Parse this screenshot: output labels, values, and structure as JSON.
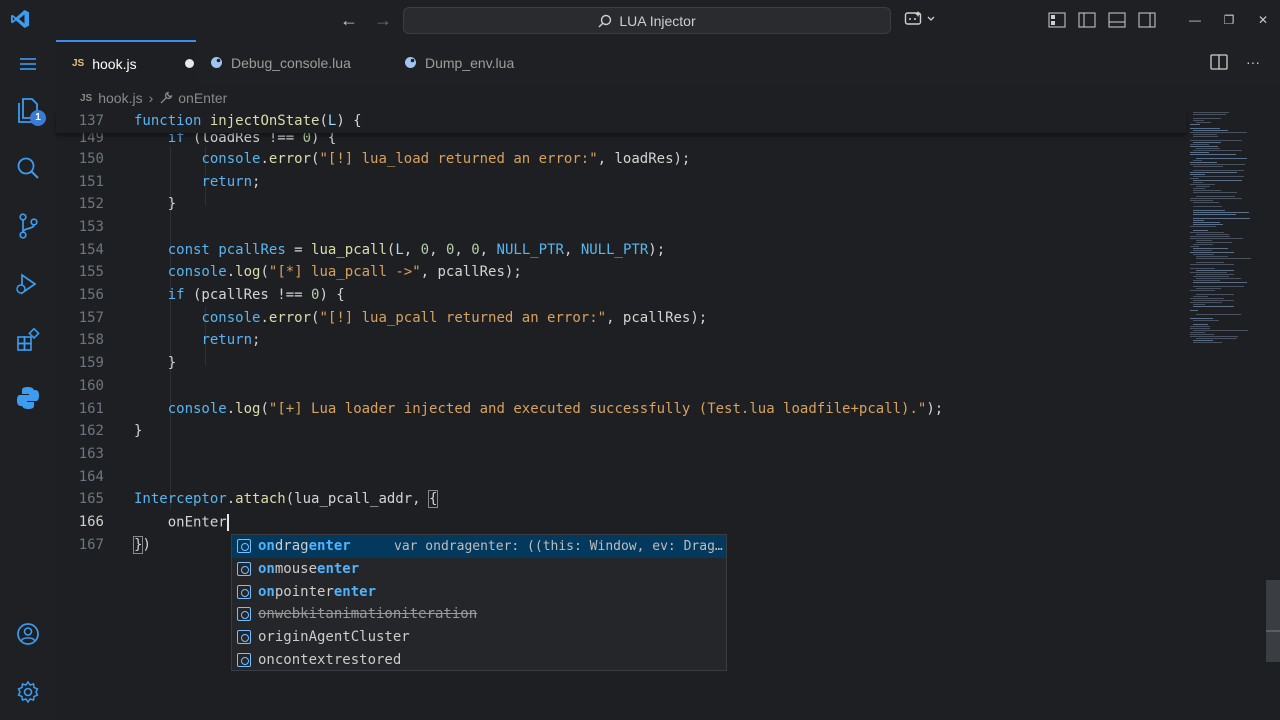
{
  "titlebar": {
    "search_text": "LUA Injector",
    "back_icon": "arrow-left-icon",
    "forward_icon": "arrow-right-icon",
    "window_controls": [
      "—",
      "❐",
      "✕"
    ]
  },
  "activity": {
    "explorer_badge": "1"
  },
  "tabs": [
    {
      "label": "hook.js",
      "badge": "JS",
      "active": true,
      "dirty": true
    },
    {
      "label": "Debug_console.lua",
      "active": false
    },
    {
      "label": "Dump_env.lua",
      "active": false
    }
  ],
  "breadcrumb": {
    "badge": "JS",
    "file": "hook.js",
    "symbol": "onEnter"
  },
  "editor": {
    "sticky_line_number": "137",
    "lines": [
      {
        "n": "149"
      },
      {
        "n": "150"
      },
      {
        "n": "151"
      },
      {
        "n": "152"
      },
      {
        "n": "153"
      },
      {
        "n": "154"
      },
      {
        "n": "155"
      },
      {
        "n": "156"
      },
      {
        "n": "157"
      },
      {
        "n": "158"
      },
      {
        "n": "159"
      },
      {
        "n": "160"
      },
      {
        "n": "161"
      },
      {
        "n": "162"
      },
      {
        "n": "163"
      },
      {
        "n": "164"
      },
      {
        "n": "165"
      },
      {
        "n": "166"
      },
      {
        "n": "167"
      }
    ],
    "current_line": "166"
  },
  "suggest": {
    "items": [
      {
        "pre": "",
        "h1": "on",
        "mid": "drag",
        "h2": "enter",
        "post": "",
        "detail": "var ondragenter: ((this: Window, ev: Drag…"
      },
      {
        "pre": "",
        "h1": "on",
        "mid": "mouse",
        "h2": "enter",
        "post": ""
      },
      {
        "pre": "",
        "h1": "on",
        "mid": "pointer",
        "h2": "enter",
        "post": ""
      },
      {
        "label": "onwebkitanimationiteration",
        "deprecated": true
      },
      {
        "label": "originAgentCluster"
      },
      {
        "label": "oncontextrestored"
      }
    ]
  },
  "colors": {
    "accent": "#3b8eea",
    "selection": "#04395e",
    "keyword": "#5ab3f5",
    "function": "#dcdcaa",
    "string": "#d6a25e"
  }
}
